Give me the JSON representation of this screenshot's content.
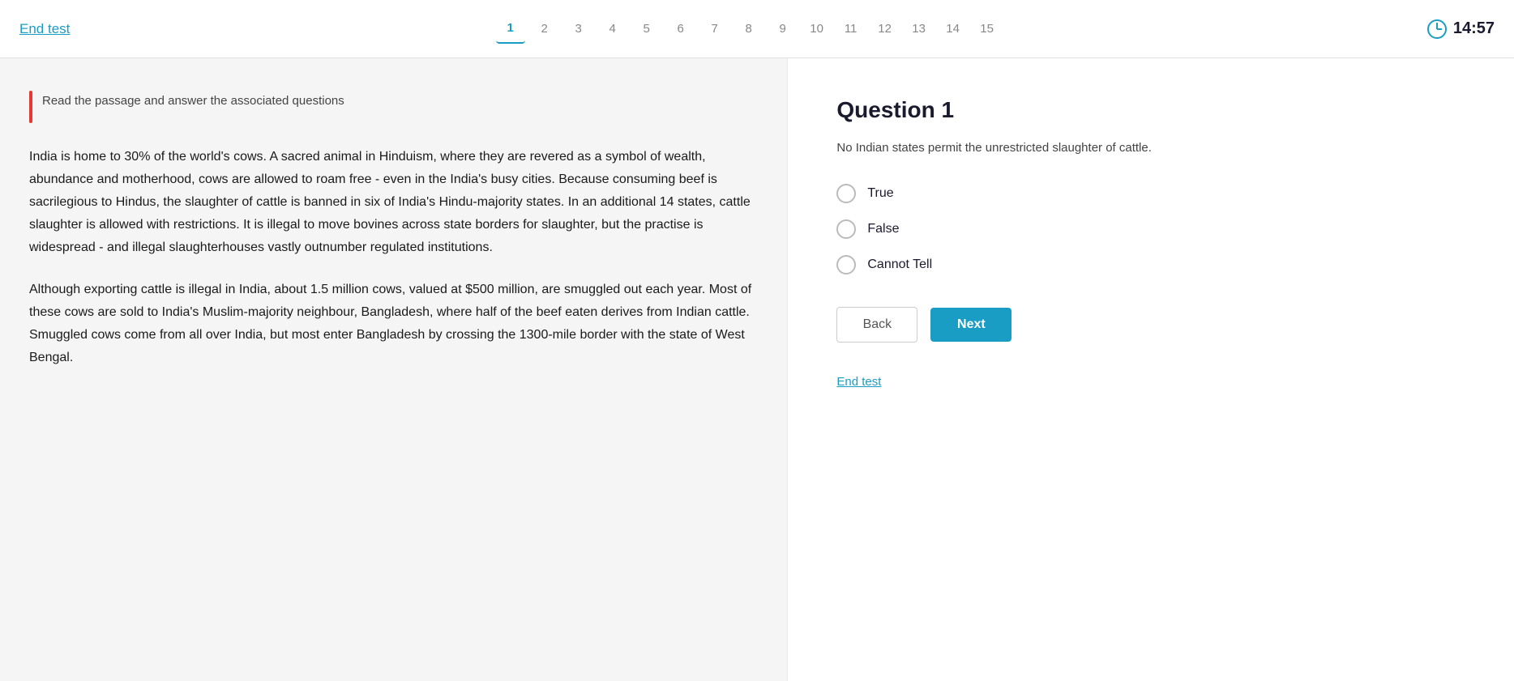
{
  "header": {
    "end_test_label": "End test",
    "question_numbers": [
      "1",
      "2",
      "3",
      "4",
      "5",
      "6",
      "7",
      "8",
      "9",
      "10",
      "11",
      "12",
      "13",
      "14",
      "15"
    ],
    "active_question": 0,
    "timer": "14:57"
  },
  "left_panel": {
    "instruction": "Read the passage and answer the associated questions",
    "passage_paragraphs": [
      "India is home to 30% of the world's cows. A sacred animal in Hinduism, where they are revered as a symbol of wealth, abundance and motherhood, cows are allowed to roam free - even in the India's busy cities. Because consuming beef is sacrilegious to Hindus, the slaughter of cattle is banned in six of India's Hindu-majority states. In an additional 14 states, cattle slaughter is allowed with restrictions. It is illegal to move bovines across state borders for slaughter, but the practise is widespread - and illegal slaughterhouses vastly outnumber regulated institutions.",
      "Although exporting cattle is illegal in India, about 1.5 million cows, valued at $500 million, are smuggled out each year. Most of these cows are sold to India's Muslim-majority neighbour, Bangladesh, where half of the beef eaten derives from Indian cattle. Smuggled cows come from all over India, but most enter Bangladesh by crossing the 1300-mile border with the state of West Bengal."
    ]
  },
  "right_panel": {
    "question_title": "Question 1",
    "question_text": "No Indian states permit the unrestricted slaughter of cattle.",
    "options": [
      {
        "label": "True",
        "id": "true"
      },
      {
        "label": "False",
        "id": "false"
      },
      {
        "label": "Cannot Tell",
        "id": "cannot-tell"
      }
    ],
    "back_label": "Back",
    "next_label": "Next",
    "end_test_label": "End test"
  },
  "colors": {
    "accent": "#1a9dc4",
    "red_bar": "#e53935",
    "active_num": "#1a9dc4"
  }
}
